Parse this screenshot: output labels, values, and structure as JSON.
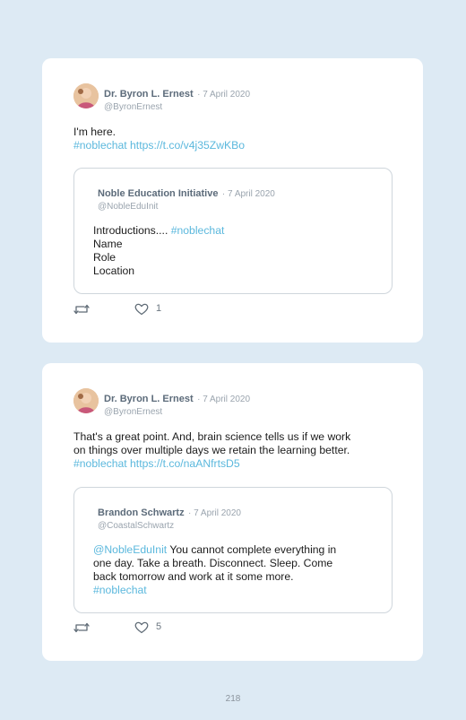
{
  "page_number": "218",
  "tweets": [
    {
      "author": {
        "name": "Dr. Byron L. Ernest",
        "date": "· 7 April 2020",
        "handle": "@ByronErnest"
      },
      "text_line1": "I'm here.",
      "hashtag": "#noblechat",
      "url": "https://t.co/v4j35ZwKBo",
      "quote": {
        "author": {
          "name": "Noble Education Initiative",
          "date": "· 7 April 2020",
          "handle": "@NobleEduInit"
        },
        "intro": "Introductions.... ",
        "hashtag": "#noblechat",
        "lines": [
          "Name",
          "Role",
          "Location"
        ]
      },
      "likes": "1"
    },
    {
      "author": {
        "name": "Dr. Byron L. Ernest",
        "date": "· 7 April 2020",
        "handle": "@ByronErnest"
      },
      "text_line1": "That's a great point. And, brain science tells us if we work",
      "text_line2": "on things over multiple days we retain the learning better.",
      "hashtag": "#noblechat",
      "url": "https://t.co/naANfrtsD5",
      "quote": {
        "author": {
          "name": "Brandon Schwartz",
          "date": "· 7 April 2020",
          "handle": "@CoastalSchwartz"
        },
        "mention": "@NobleEduInit",
        "line1_rest": " You cannot complete everything in",
        "line2": "one day. Take a breath. Disconnect. Sleep. Come",
        "line3": "back tomorrow and work at it some more.",
        "hashtag": "#noblechat"
      },
      "likes": "5"
    }
  ],
  "icons": {
    "retweet": "retweet-icon",
    "like": "heart-icon"
  },
  "colors": {
    "link": "#5bb8dd",
    "background": "#ddeaf4",
    "card": "#ffffff"
  }
}
